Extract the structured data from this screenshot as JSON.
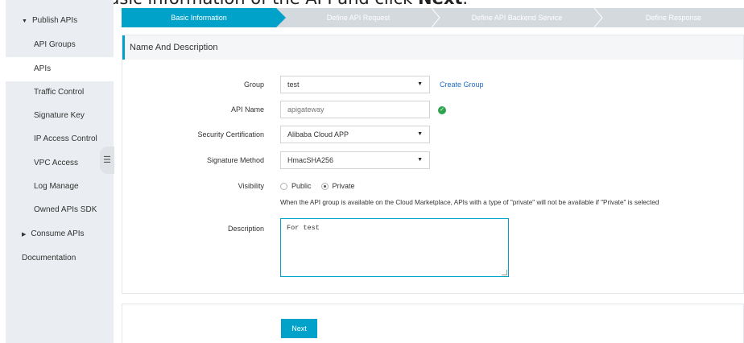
{
  "caption": {
    "prefix": "Enter the basic information of the API and click ",
    "action": "Next",
    "suffix": "."
  },
  "sidebar": {
    "publish_apis": "Publish APIs",
    "items": [
      {
        "label": "API Groups"
      },
      {
        "label": "APIs"
      },
      {
        "label": "Traffic Control"
      },
      {
        "label": "Signature Key"
      },
      {
        "label": "IP Access Control"
      },
      {
        "label": "VPC Access"
      },
      {
        "label": "Log Manage"
      },
      {
        "label": "Owned APIs SDK"
      }
    ],
    "consume_apis": "Consume APIs",
    "documentation": "Documentation",
    "collapse_glyph": "☰"
  },
  "steps": [
    {
      "label": "Basic Information"
    },
    {
      "label": "Define API Request"
    },
    {
      "label": "Define API Backend Service"
    },
    {
      "label": "Define Response"
    }
  ],
  "panel": {
    "title": "Name And Description"
  },
  "form": {
    "group": {
      "label": "Group",
      "value": "test",
      "create_link": "Create Group"
    },
    "api_name": {
      "label": "API Name",
      "value": "apigateway"
    },
    "security_certification": {
      "label": "Security Certification",
      "value": "Alibaba Cloud APP"
    },
    "signature_method": {
      "label": "Signature Method",
      "value": "HmacSHA256"
    },
    "visibility": {
      "label": "Visibility",
      "options": [
        "Public",
        "Private"
      ],
      "selected": "Private",
      "hint": "When the API group is available on the Cloud Marketplace, APIs with a type of \"private\" will not be available if \"Private\" is selected"
    },
    "description": {
      "label": "Description",
      "value": "For test"
    }
  },
  "footer": {
    "next_label": "Next"
  },
  "colors": {
    "accent": "#00a2ca",
    "success": "#2ea44f",
    "link": "#1e6ec6",
    "sidebar_bg": "#eaedf1"
  }
}
